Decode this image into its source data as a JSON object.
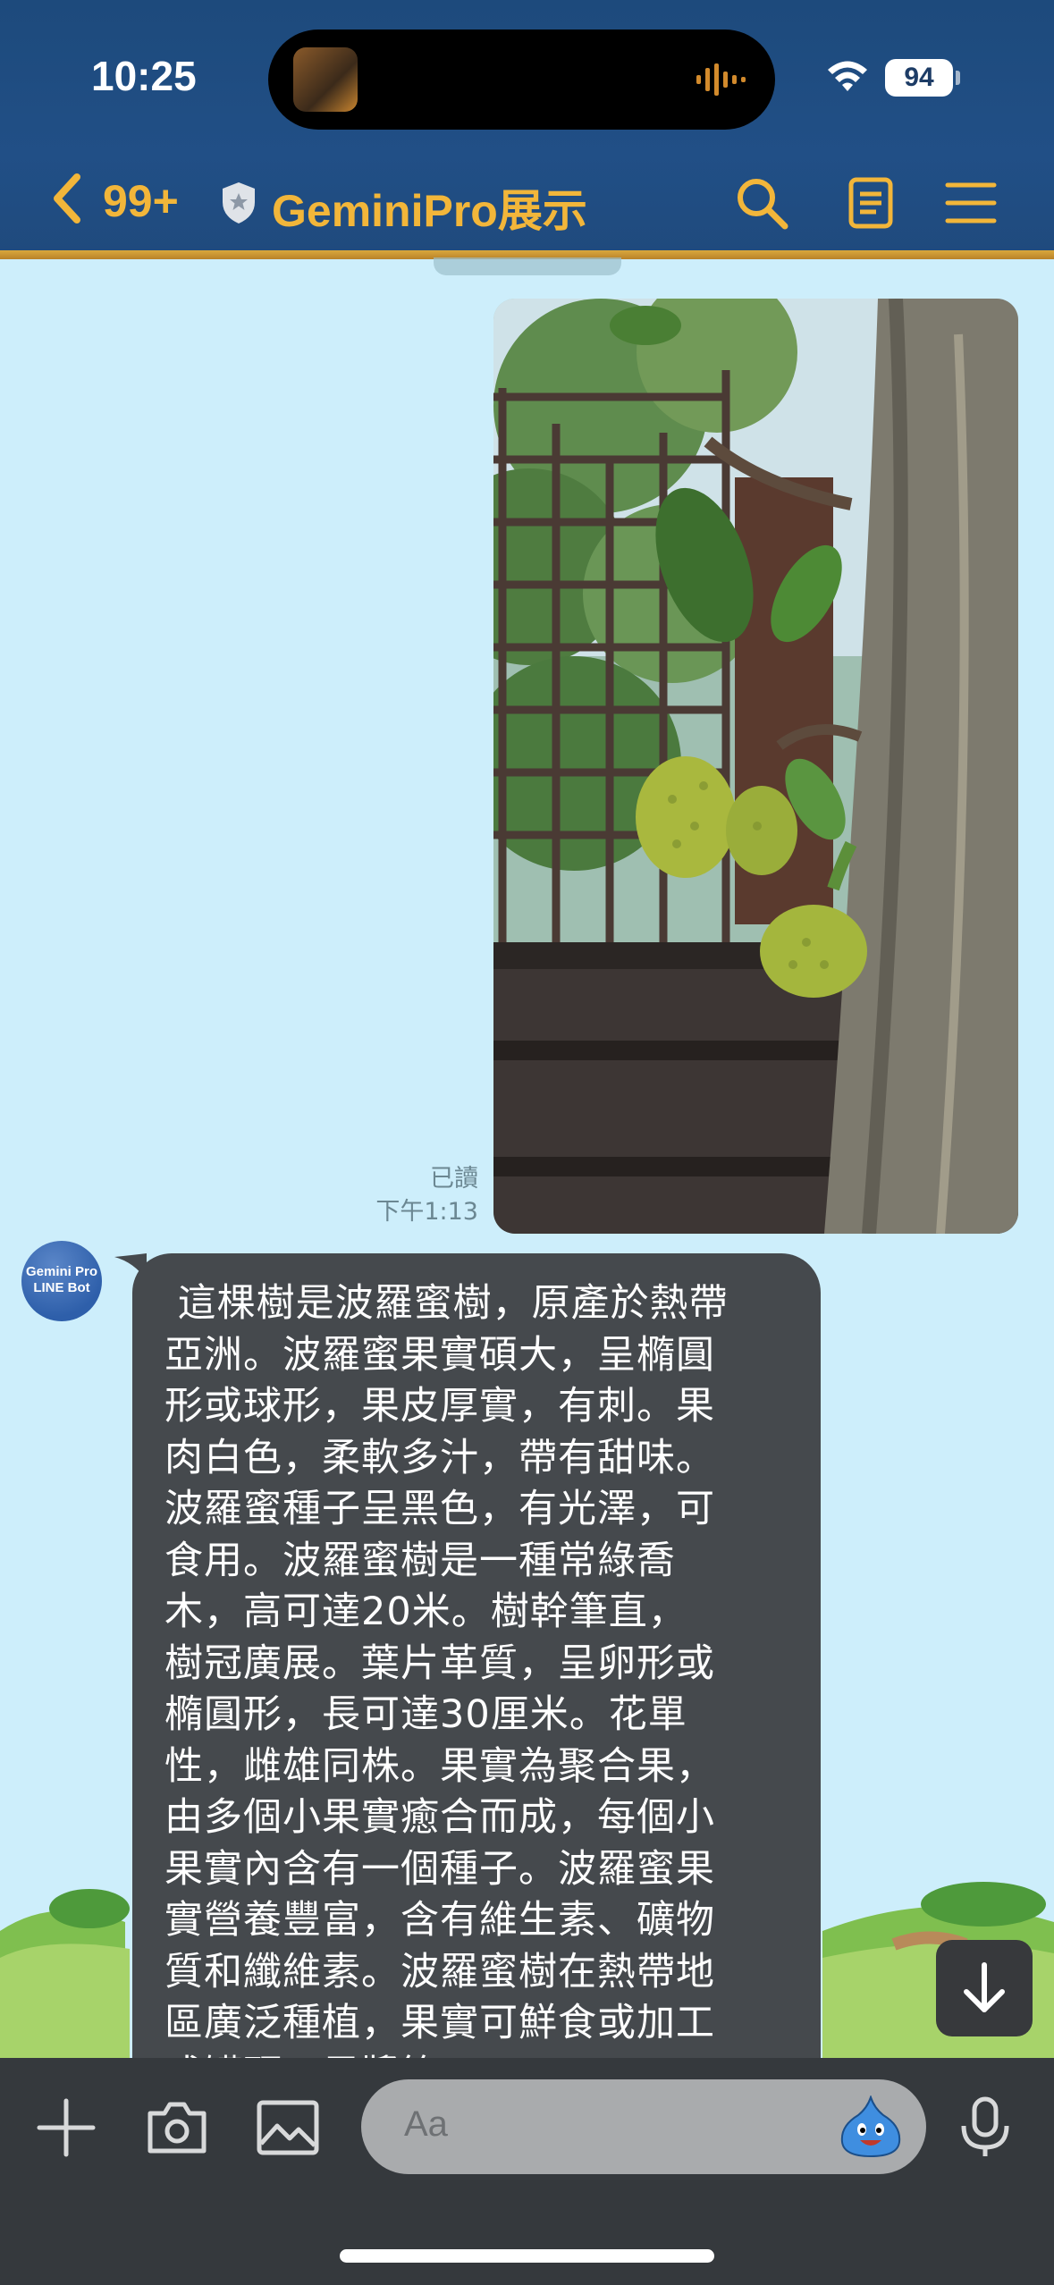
{
  "status_bar": {
    "time": "10:25",
    "battery": "94"
  },
  "header": {
    "unread_count": "99+",
    "title": "GeminiPro展示"
  },
  "messages": {
    "sent_photo_label": "jackfruit tree photo",
    "read_status": "已讀",
    "sent_time": "下午1:13",
    "bot_avatar_line1": "Gemini Pro",
    "bot_avatar_line2": "LINE Bot",
    "bot_reply": " 這棵樹是波羅蜜樹，原產於熱帶\n亞洲。波羅蜜果實碩大，呈橢圓\n形或球形，果皮厚實，有刺。果\n肉白色，柔軟多汁，帶有甜味。\n波羅蜜種子呈黑色，有光澤，可\n食用。波羅蜜樹是一種常綠喬\n木，高可達20米。樹幹筆直，\n樹冠廣展。葉片革質，呈卵形或\n橢圓形，長可達30厘米。花單\n性，雌雄同株。果實為聚合果，\n由多個小果實癒合而成，每個小\n果實內含有一個種子。波羅蜜果\n實營養豐富，含有維生素、礦物\n質和纖維素。波羅蜜樹在熱帶地\n區廣泛種植，果實可鮮食或加工\n成罐頭、果醬等。"
  },
  "composer": {
    "placeholder": "Aa"
  },
  "colors": {
    "header_bg": "#214f86",
    "accent": "#f2b63a",
    "chat_bg": "#cdeefb",
    "bubble": "#45494d"
  }
}
